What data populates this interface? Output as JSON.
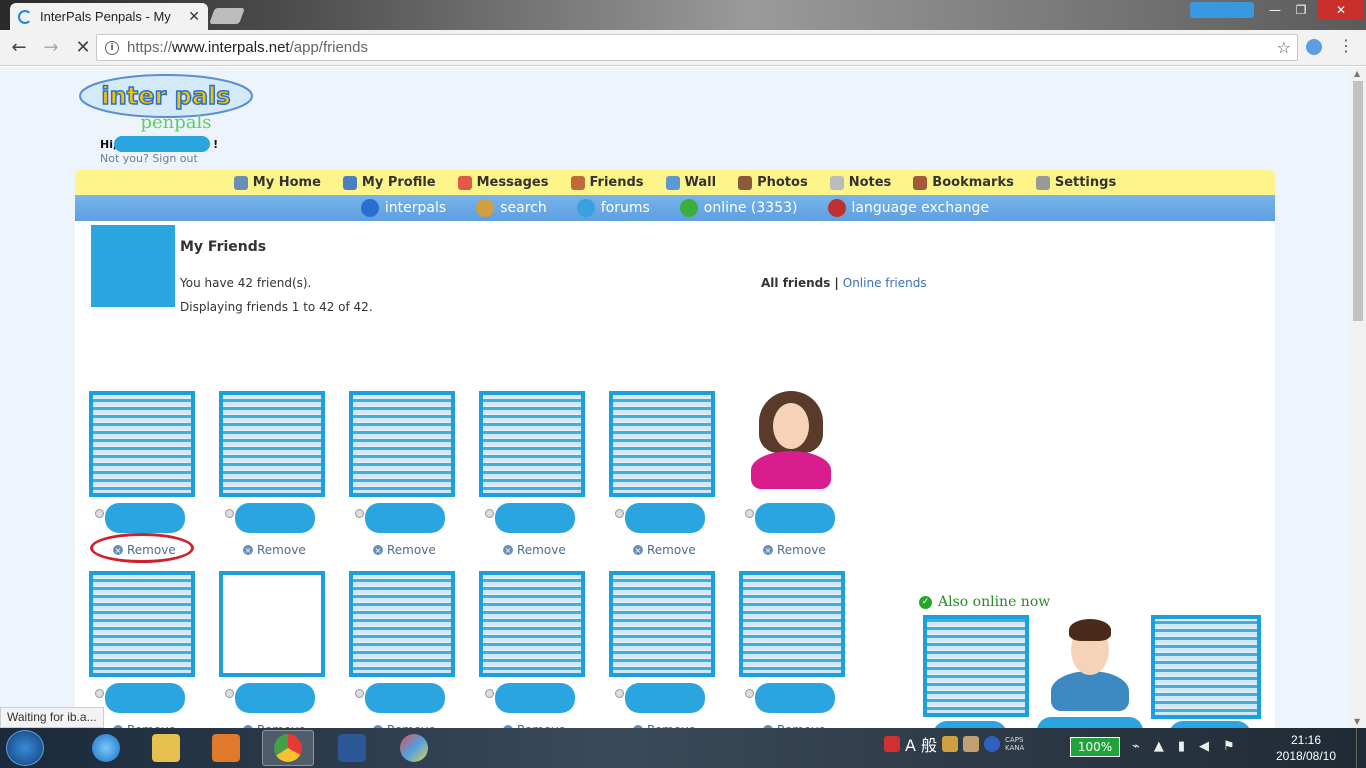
{
  "browser": {
    "tab_title": "InterPals Penpals - My",
    "tab_close": "✕",
    "url_scheme": "https://",
    "url_host": "www.interpals.net",
    "url_path": "/app/friends",
    "window_controls": {
      "minimize": "—",
      "maximize": "❐",
      "close": "✕"
    }
  },
  "header": {
    "logo_top": "inter pals",
    "logo_bottom": "penpals",
    "greeting": "Hi,",
    "greeting_end": "!",
    "signout": "Not you? Sign out"
  },
  "nav_primary": [
    {
      "label": "My Home",
      "icon": "home-icon",
      "color": "#6a8fb4"
    },
    {
      "label": "My Profile",
      "icon": "profile-icon",
      "color": "#4a7fc0"
    },
    {
      "label": "Messages",
      "icon": "envelope-icon",
      "color": "#e05a4a"
    },
    {
      "label": "Friends",
      "icon": "friends-icon",
      "color": "#c06a3a"
    },
    {
      "label": "Wall",
      "icon": "wall-icon",
      "color": "#5a9ad0"
    },
    {
      "label": "Photos",
      "icon": "photo-icon",
      "color": "#8a5a3a"
    },
    {
      "label": "Notes",
      "icon": "notes-icon",
      "color": "#bbbbbb"
    },
    {
      "label": "Bookmarks",
      "icon": "bookmark-icon",
      "color": "#a05a3a"
    },
    {
      "label": "Settings",
      "icon": "settings-icon",
      "color": "#999999"
    }
  ],
  "nav_secondary": [
    {
      "label": "interpals",
      "icon": "globe-icon",
      "color": "#2a6fd0"
    },
    {
      "label": "search",
      "icon": "search-icon",
      "color": "#d0a040"
    },
    {
      "label": "forums",
      "icon": "forums-icon",
      "color": "#3aa0e0"
    },
    {
      "label": "online (3353)",
      "icon": "online-user-icon",
      "color": "#3ab03a"
    },
    {
      "label": "language exchange",
      "icon": "flag-icon",
      "color": "#c03030"
    }
  ],
  "friends_page": {
    "title": "My Friends",
    "count_text": "You have 42 friend(s).",
    "display_text": "Displaying friends 1 to 42 of 42.",
    "filter_all": "All friends",
    "filter_separator": "|",
    "filter_online": "Online friends",
    "remove_label": "Remove"
  },
  "friends": [
    {
      "avatar": "photo",
      "name": "",
      "remove": "Remove"
    },
    {
      "avatar": "photo",
      "name": "",
      "remove": "Remove"
    },
    {
      "avatar": "photo",
      "name": "",
      "remove": "Remove"
    },
    {
      "avatar": "photo",
      "name": "",
      "remove": "Remove"
    },
    {
      "avatar": "photo",
      "name": "",
      "remove": "Remove"
    },
    {
      "avatar": "default-female",
      "name": "",
      "remove": "Remove"
    },
    {
      "avatar": "photo",
      "name": "",
      "remove": "Remove"
    },
    {
      "avatar": "blank",
      "name": "",
      "remove": "Remove"
    },
    {
      "avatar": "photo",
      "name": "",
      "remove": "Remove"
    },
    {
      "avatar": "photo",
      "name": "",
      "remove": "Remove"
    },
    {
      "avatar": "photo",
      "name": "",
      "remove": "Remove"
    },
    {
      "avatar": "photo",
      "name": "",
      "remove": "Remove"
    }
  ],
  "also_online": {
    "title": "Also online now"
  },
  "status_bar": "Waiting for ib.a...",
  "taskbar": {
    "ime_label": "A 般",
    "caps": "CAPS",
    "kana": "KANA",
    "battery": "100%",
    "time": "21:16",
    "date": "2018/08/10"
  }
}
